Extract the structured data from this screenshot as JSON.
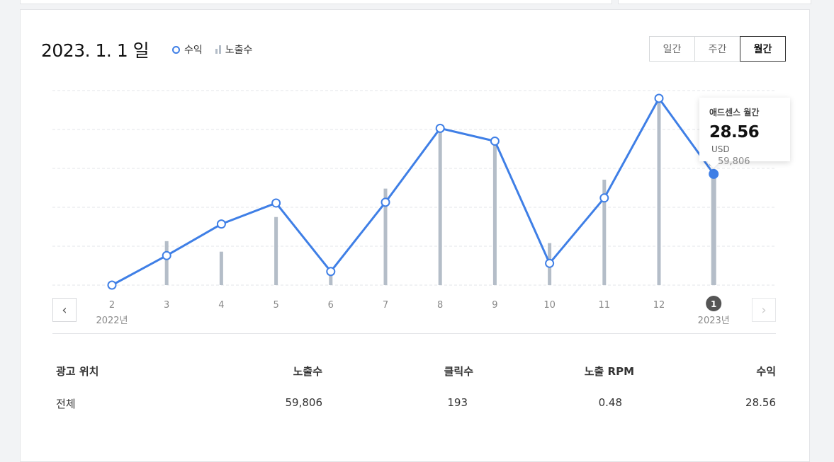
{
  "header": {
    "date_title": "2023. 1. 1 일",
    "legend_revenue": "수익",
    "legend_impressions": "노출수"
  },
  "period_tabs": [
    {
      "label": "일간",
      "active": false
    },
    {
      "label": "주간",
      "active": false
    },
    {
      "label": "월간",
      "active": true
    }
  ],
  "nav": {
    "prev_icon": "chevron-left-icon",
    "next_icon": "chevron-right-icon"
  },
  "tooltip": {
    "title": "애드센스 월간",
    "value": "28.56",
    "unit": "USD",
    "impressions": "59,806"
  },
  "chart_data": {
    "type": "line",
    "categories": [
      "2",
      "3",
      "4",
      "5",
      "6",
      "7",
      "8",
      "9",
      "10",
      "11",
      "12",
      "1"
    ],
    "year_labels": [
      "2022년",
      "",
      "",
      "",
      "",
      "",
      "",
      "",
      "",
      "",
      "",
      "2023년"
    ],
    "series": [
      {
        "name": "수익",
        "values": [
          0.0,
          7.6,
          15.7,
          21.1,
          3.5,
          21.3,
          40.3,
          37.0,
          5.6,
          22.4,
          48.0,
          28.56
        ],
        "color": "#3f7fe6"
      },
      {
        "name": "노출수",
        "values": [
          0,
          11300,
          8600,
          17500,
          2600,
          24800,
          40200,
          36500,
          10800,
          27100,
          48500,
          28500
        ],
        "color": "#b4bdc8"
      }
    ],
    "highlight_index": 11,
    "grid": true
  },
  "table": {
    "headers": [
      "광고 위치",
      "노출수",
      "클릭수",
      "노출 RPM",
      "수익"
    ],
    "rows": [
      [
        "전체",
        "59,806",
        "193",
        "0.48",
        "28.56"
      ]
    ]
  },
  "colors": {
    "accent": "#3f7fe6",
    "bar": "#b4bdc8",
    "grid": "#e3e5e8"
  }
}
